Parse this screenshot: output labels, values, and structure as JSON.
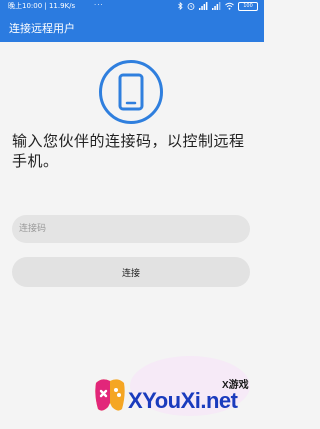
{
  "status_bar": {
    "time_speed": "晚上10:00 | 11.9K/s",
    "more": "···",
    "battery": "100"
  },
  "app_bar": {
    "title": "连接远程用户"
  },
  "main": {
    "instruction": "输入您伙伴的连接码，以控制远程手机。",
    "code_input": {
      "value": "",
      "placeholder": "连接码"
    },
    "connect_button_label": "连接"
  },
  "watermark": {
    "small": "X游戏",
    "big": "XYouXi.net"
  },
  "colors": {
    "primary": "#2b7be0",
    "icon_blue": "#2f7fde",
    "watermark_blue": "#1a3bbd"
  }
}
